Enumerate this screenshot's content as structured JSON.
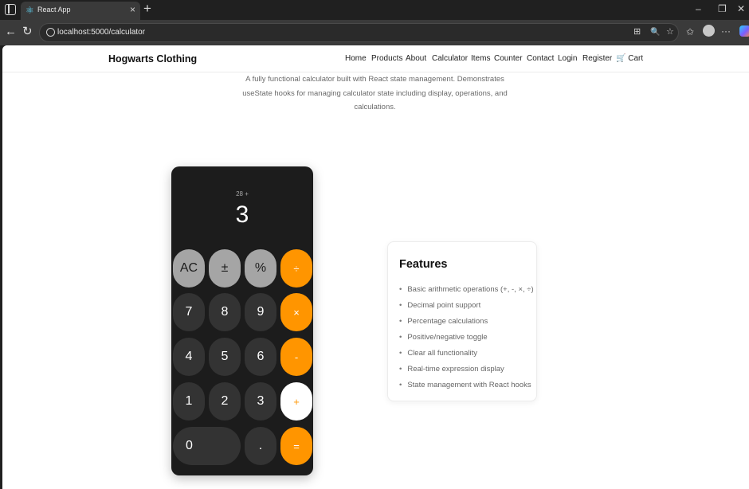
{
  "browser": {
    "tab_title": "React App",
    "tab_favicon": "react-icon",
    "close_tab": "×",
    "new_tab": "+",
    "url": "localhost:5000/calculator",
    "window_controls": {
      "minimize": "–",
      "maximize": "❐",
      "close": "✕"
    },
    "nav": {
      "back": "←",
      "refresh": "↻"
    },
    "toolbar": {
      "app_available": "⊞",
      "zoom": "🔍",
      "favorite": "☆",
      "favorites": "✩",
      "more": "···"
    }
  },
  "site": {
    "brand": "Hogwarts Clothing",
    "nav": [
      "Home",
      "Products",
      "About",
      "Calculator",
      "Items",
      "Counter",
      "Contact",
      "Login",
      "Register",
      "🛒 Cart"
    ]
  },
  "page": {
    "description": "A fully functional calculator built with React state management. Demonstrates useState hooks for managing calculator state including display, operations, and calculations."
  },
  "calculator": {
    "expression": "28 +",
    "display": "3",
    "keys": {
      "clear": "AC",
      "toggle_sign": "±",
      "percent": "%",
      "divide": "÷",
      "seven": "7",
      "eight": "8",
      "nine": "9",
      "multiply": "×",
      "four": "4",
      "five": "5",
      "six": "6",
      "subtract": "-",
      "one": "1",
      "two": "2",
      "three": "3",
      "add": "+",
      "zero": "0",
      "decimal": ".",
      "equals": "="
    },
    "colors": {
      "operator": "#ff9500",
      "function": "#a5a5a5",
      "number": "#333333",
      "body": "#1c1c1c"
    }
  },
  "features": {
    "title": "Features",
    "items": [
      "Basic arithmetic operations (+, -, ×, ÷)",
      "Decimal point support",
      "Percentage calculations",
      "Positive/negative toggle",
      "Clear all functionality",
      "Real-time expression display",
      "State management with React hooks"
    ]
  }
}
